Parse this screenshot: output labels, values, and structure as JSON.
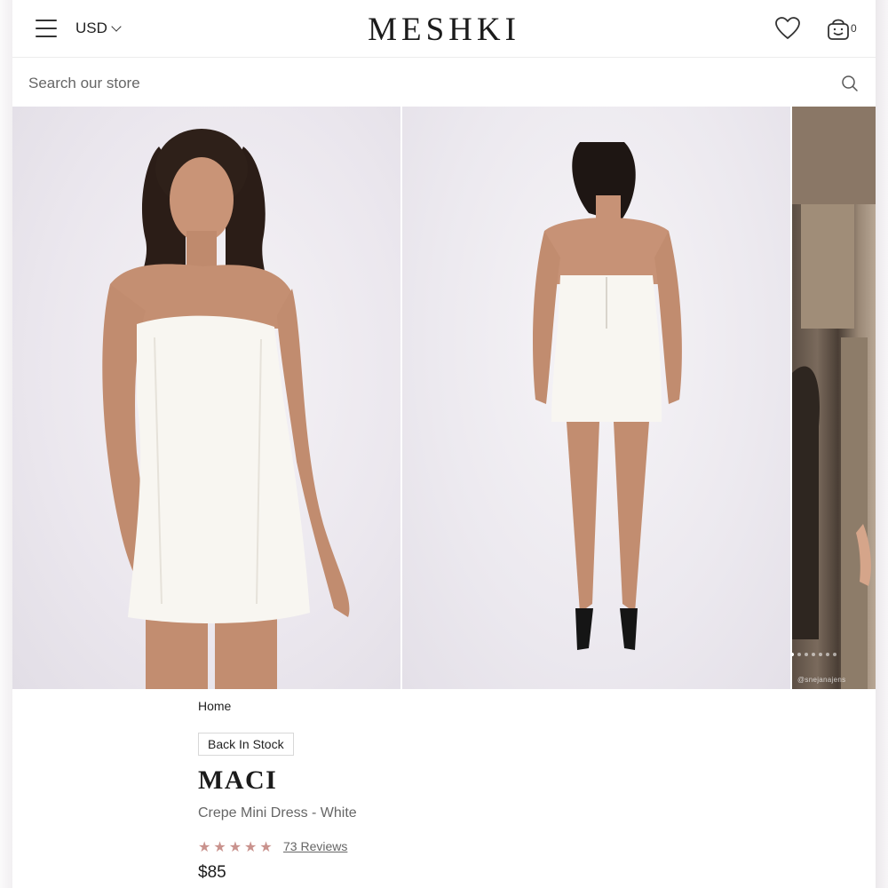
{
  "header": {
    "currency": "USD",
    "logo": "MESHKI",
    "cart_count": "0"
  },
  "search": {
    "placeholder": "Search our store"
  },
  "gallery": {
    "slides": [
      "front view",
      "back view",
      "lifestyle"
    ],
    "active_slide": 1,
    "dot_count": 7,
    "credit": "@snejanajens"
  },
  "product": {
    "breadcrumb": "Home",
    "badge": "Back In Stock",
    "name": "MACI",
    "subtitle": "Crepe Mini Dress - White",
    "rating": 5,
    "reviews_label": "73 Reviews",
    "price": "$85"
  },
  "colors": {
    "star": "#c9928d",
    "text": "#1b1b1b",
    "muted": "#666666"
  }
}
